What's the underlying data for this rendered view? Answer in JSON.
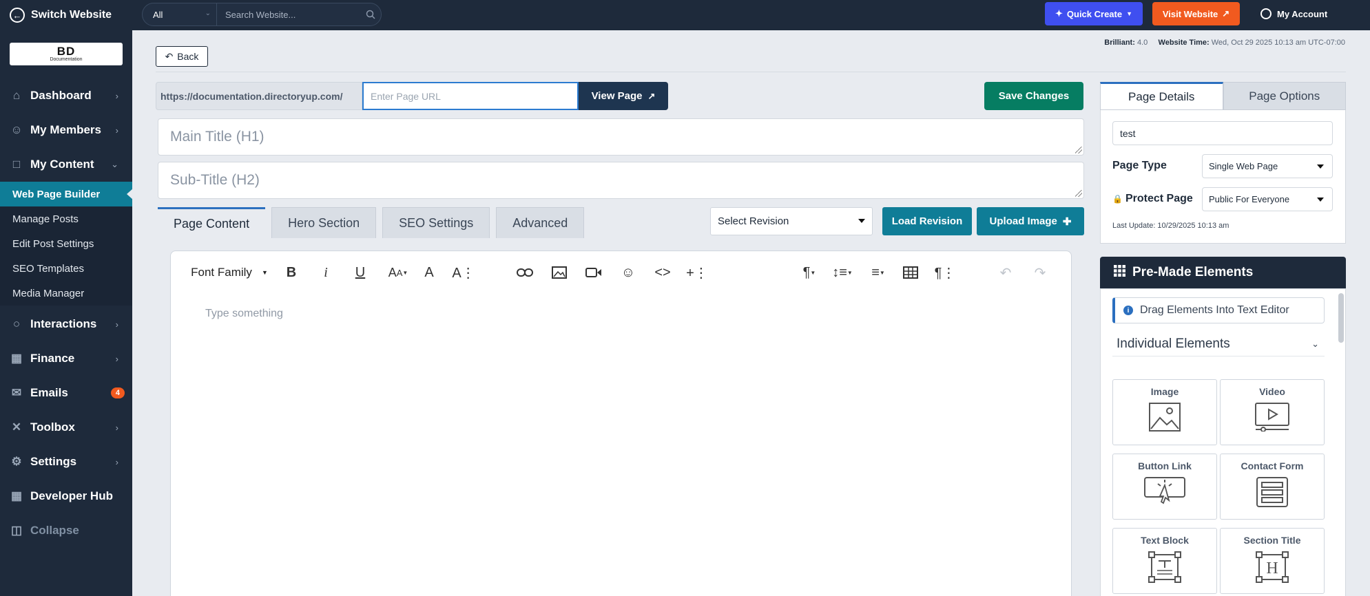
{
  "topbar": {
    "switch_label": "Switch Website",
    "search_scope": "All",
    "search_placeholder": "Search Website...",
    "quick_create": "Quick Create",
    "visit_website": "Visit Website",
    "my_account": "My Account"
  },
  "sidebar": {
    "logo_main": "BD",
    "logo_sub": "Documentation",
    "items": [
      {
        "label": "Dashboard"
      },
      {
        "label": "My Members"
      },
      {
        "label": "My Content"
      },
      {
        "label": "Interactions"
      },
      {
        "label": "Finance"
      },
      {
        "label": "Emails",
        "badge": "4"
      },
      {
        "label": "Toolbox"
      },
      {
        "label": "Settings"
      },
      {
        "label": "Developer Hub"
      },
      {
        "label": "Collapse"
      }
    ],
    "sub_items": [
      {
        "label": "Web Page Builder"
      },
      {
        "label": "Manage Posts"
      },
      {
        "label": "Edit Post Settings"
      },
      {
        "label": "SEO Templates"
      },
      {
        "label": "Media Manager"
      }
    ]
  },
  "info": {
    "version_label": "Brilliant:",
    "version": "4.0",
    "time_label": "Website Time:",
    "time": "Wed, Oct 29 2025 10:13 am UTC-07:00"
  },
  "page": {
    "back": "Back",
    "url_prefix": "https://documentation.directoryup.com/",
    "url_placeholder": "Enter Page URL",
    "view_page": "View Page",
    "save_changes": "Save Changes",
    "main_title_placeholder": "Main Title (H1)",
    "subtitle_placeholder": "Sub-Title (H2)",
    "tabs": [
      "Page Content",
      "Hero Section",
      "SEO Settings",
      "Advanced"
    ],
    "select_revision": "Select Revision",
    "load_revision": "Load Revision",
    "upload_image": "Upload Image",
    "editor": {
      "font_family": "Font Family",
      "placeholder": "Type something"
    }
  },
  "details": {
    "tabs": [
      "Page Details",
      "Page Options"
    ],
    "name_value": "test",
    "page_type_label": "Page Type",
    "page_type_value": "Single Web Page",
    "protect_label": "Protect Page",
    "protect_value": "Public For Everyone",
    "last_update": "Last Update: 10/29/2025 10:13 am"
  },
  "premade": {
    "title": "Pre-Made Elements",
    "drag_note": "Drag Elements Into Text Editor",
    "section": "Individual Elements",
    "elements": [
      {
        "label": "Image",
        "icon": "image-icon"
      },
      {
        "label": "Video",
        "icon": "video-icon"
      },
      {
        "label": "Button Link",
        "icon": "button-link-icon"
      },
      {
        "label": "Contact Form",
        "icon": "form-icon"
      },
      {
        "label": "Text Block",
        "icon": "text-block-icon"
      },
      {
        "label": "Section Title",
        "icon": "section-title-icon"
      }
    ]
  },
  "colors": {
    "navy": "#1e2a3b",
    "teal": "#0f7d97",
    "green": "#067d62",
    "orange": "#f15a1f",
    "blue": "#3f4ff0"
  }
}
